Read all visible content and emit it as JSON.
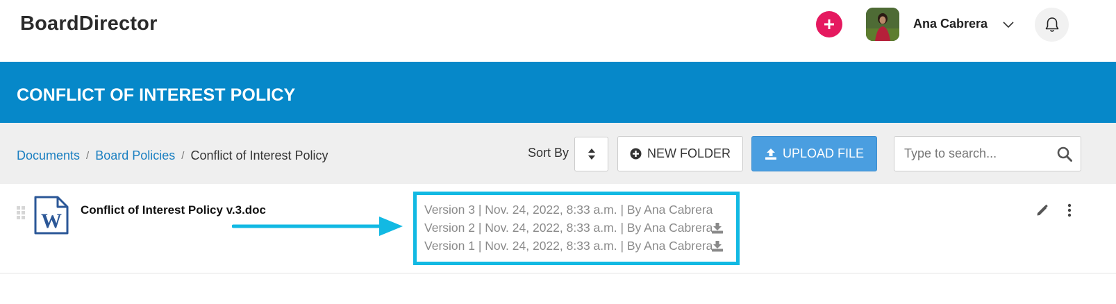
{
  "header": {
    "brand": "BoardDirector",
    "user_name": "Ana Cabrera",
    "add_icon": "plus-icon",
    "chevron_icon": "chevron-down-icon",
    "bell_icon": "bell-icon",
    "accent_color": "#e5195f"
  },
  "title_band": {
    "title": "CONFLICT OF INTEREST POLICY",
    "color": "#0688c9"
  },
  "toolbar": {
    "breadcrumb": [
      "Documents",
      "Board Policies",
      "Conflict of Interest Policy"
    ],
    "sort_label": "Sort By",
    "new_folder_label": "NEW FOLDER",
    "upload_label": "UPLOAD FILE",
    "search_placeholder": "Type to search..."
  },
  "document": {
    "name": "Conflict of Interest Policy v.3.doc",
    "file_icon": "word-doc-icon",
    "versions": [
      "Version 3 | Nov. 24, 2022, 8:33 a.m. | By Ana Cabrera",
      "Version 2 | Nov. 24, 2022, 8:33 a.m. | By Ana Cabrera",
      "Version 1 | Nov. 24, 2022, 8:33 a.m. | By Ana Cabrera"
    ],
    "highlight_color": "#12b9e3"
  }
}
